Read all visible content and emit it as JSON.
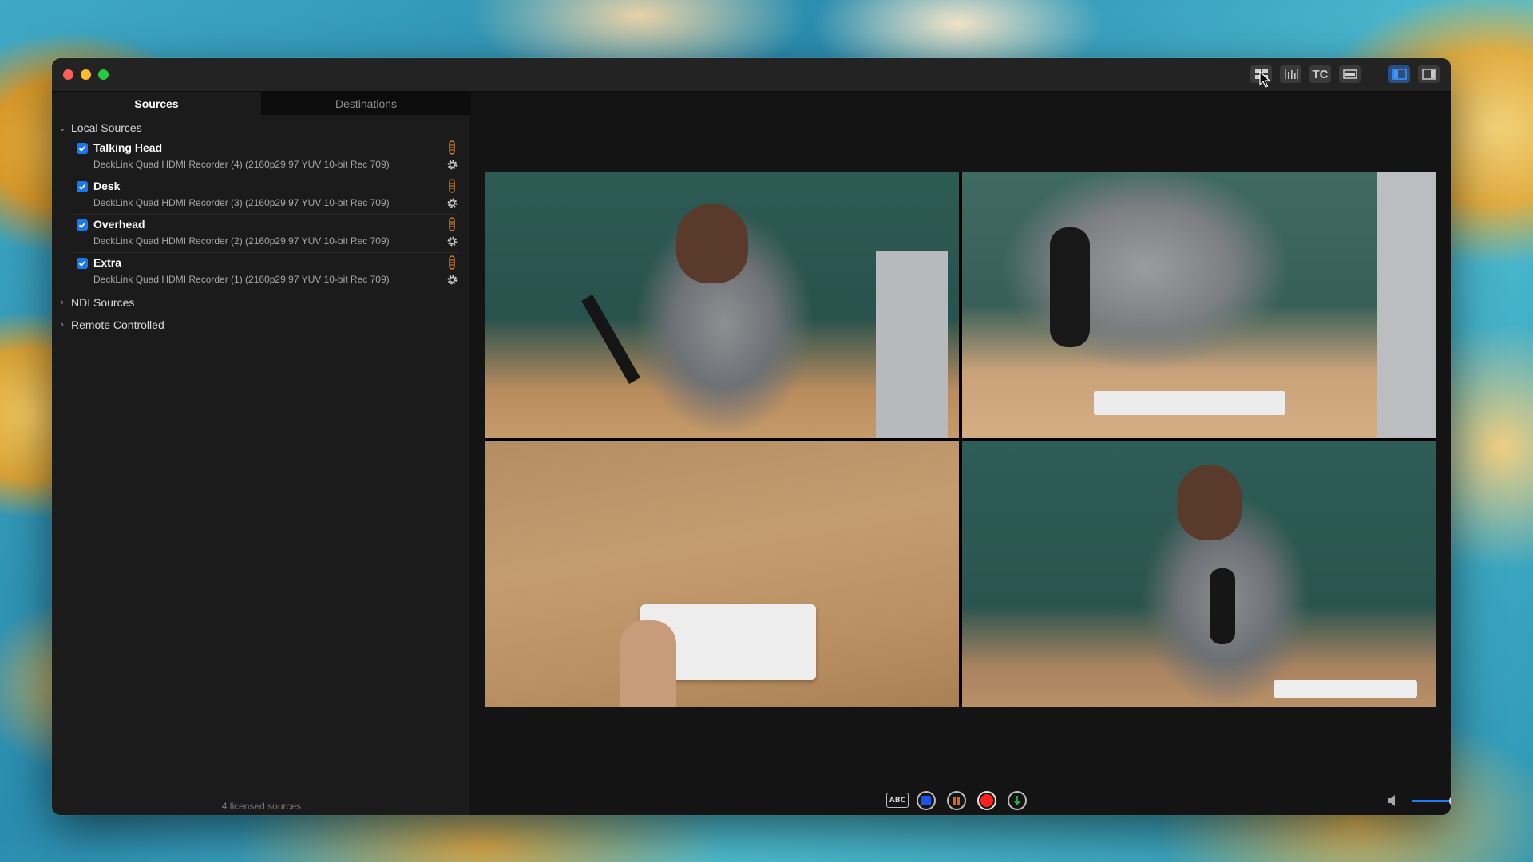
{
  "window": {
    "toolbar": {
      "multiview_icon": "grid-layout-icon",
      "audio_meters_icon": "audio-meters-icon",
      "timecode_label": "TC",
      "filmstrip_icon": "single-view-icon",
      "left_panel_icon": "left-panel-icon",
      "right_panel_icon": "right-panel-icon",
      "active_color": "#1c7cf4"
    },
    "sidebar": {
      "tabs": [
        {
          "label": "Sources",
          "selected": true
        },
        {
          "label": "Destinations",
          "selected": false
        }
      ],
      "groups": {
        "local": {
          "label": "Local Sources",
          "expanded": true
        },
        "ndi": {
          "label": "NDI Sources",
          "expanded": false
        },
        "remote": {
          "label": "Remote Controlled",
          "expanded": false
        }
      },
      "sources": [
        {
          "name": "Talking Head",
          "device": "DeckLink Quad HDMI Recorder (4) (2160p29.97 YUV 10-bit Rec 709)",
          "checked": true
        },
        {
          "name": "Desk",
          "device": "DeckLink Quad HDMI Recorder (3) (2160p29.97 YUV 10-bit Rec 709)",
          "checked": true
        },
        {
          "name": "Overhead",
          "device": "DeckLink Quad HDMI Recorder (2) (2160p29.97 YUV 10-bit Rec 709)",
          "checked": true
        },
        {
          "name": "Extra",
          "device": "DeckLink Quad HDMI Recorder (1) (2160p29.97 YUV 10-bit Rec 709)",
          "checked": true
        }
      ],
      "footer": "4 licensed sources"
    },
    "controls": {
      "abc_label": "ABC",
      "stop_color": "#1c56e8",
      "pause_color": "#e0641c",
      "record_color": "#ff1f1f",
      "marker_color": "#2bb045",
      "volume": 0.7
    }
  }
}
